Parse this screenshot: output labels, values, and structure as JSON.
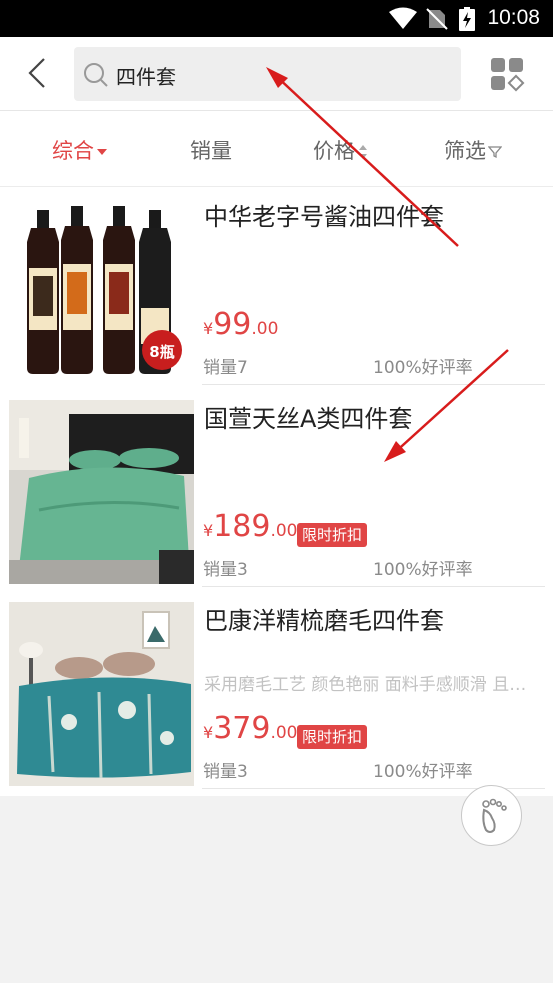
{
  "status_bar": {
    "time": "10:08"
  },
  "header": {
    "search_value": "四件套"
  },
  "sort_tabs": [
    {
      "label": "综合",
      "active": true
    },
    {
      "label": "销量",
      "active": false
    },
    {
      "label": "价格",
      "active": false
    },
    {
      "label": "筛选",
      "active": false
    }
  ],
  "products": [
    {
      "title": "中华老字号酱油四件套",
      "subtitle": "",
      "currency": "¥",
      "price_int": "99",
      "price_dec": ".00",
      "badge": "",
      "sales": "销量7",
      "rating": "100%好评率",
      "thumb_badge": "8瓶"
    },
    {
      "title": "国萱天丝A类四件套",
      "subtitle": "",
      "currency": "¥",
      "price_int": "189",
      "price_dec": ".00",
      "badge": "限时折扣",
      "sales": "销量3",
      "rating": "100%好评率"
    },
    {
      "title": "巴康洋精梳磨毛四件套",
      "subtitle": "采用磨毛工艺 颜色艳丽 面料手感顺滑 且…",
      "currency": "¥",
      "price_int": "379",
      "price_dec": ".00",
      "badge": "限时折扣",
      "sales": "销量3",
      "rating": "100%好评率"
    }
  ],
  "colors": {
    "accent": "#e04545",
    "annotation_arrow": "#d81c1c"
  },
  "icons": [
    "wifi-icon",
    "no-sim-icon",
    "battery-charging-icon",
    "back-arrow-icon",
    "search-icon",
    "grid-view-icon",
    "sort-down-triangle-icon",
    "sort-updown-icon",
    "filter-funnel-icon",
    "footprint-icon"
  ]
}
